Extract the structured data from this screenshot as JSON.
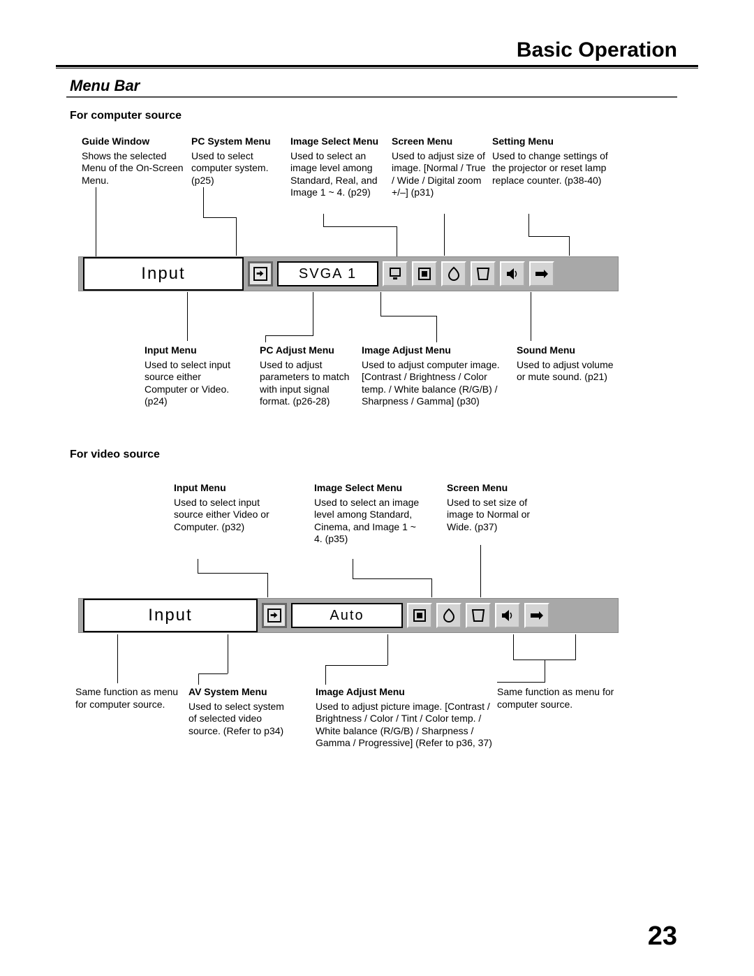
{
  "pageHeader": "Basic Operation",
  "pageNumber": "23",
  "sectionTitle": "Menu Bar",
  "computer": {
    "heading": "For computer source",
    "menubar": {
      "guide": "Input",
      "sys": "SVGA 1"
    },
    "top": {
      "guide": {
        "h": "Guide Window",
        "b": "Shows the selected Menu of the On-Screen Menu."
      },
      "pcsys": {
        "h": "PC System Menu",
        "b": "Used to select computer system. (p25)"
      },
      "imgsel": {
        "h": "Image Select Menu",
        "b": "Used to select  an image level among Standard, Real, and Image 1 ~ 4. (p29)"
      },
      "screen": {
        "h": "Screen Menu",
        "b": "Used to adjust size of image.  [Normal / True / Wide / Digital zoom +/–] (p31)"
      },
      "setting": {
        "h": "Setting Menu",
        "b": "Used to change settings of the projector or reset  lamp replace counter.   (p38-40)"
      }
    },
    "bottom": {
      "input": {
        "h": "Input Menu",
        "b": "Used to select input source either Computer or Video.  (p24)"
      },
      "pcadj": {
        "h": "PC Adjust Menu",
        "b": "Used to adjust parameters to match with input signal format. (p26-28)"
      },
      "imgadj": {
        "h": "Image Adjust Menu",
        "b": "Used to adjust computer image. [Contrast / Brightness / Color temp. /  White balance (R/G/B) / Sharpness /  Gamma]   (p30)"
      },
      "sound": {
        "h": "Sound Menu",
        "b": "Used to adjust volume or mute sound.  (p21)"
      }
    }
  },
  "video": {
    "heading": "For video source",
    "menubar": {
      "guide": "Input",
      "sys": "Auto"
    },
    "top": {
      "input": {
        "h": "Input Menu",
        "b": "Used to select input source either Video or Computer. (p32)"
      },
      "imgsel": {
        "h": "Image Select Menu",
        "b": "Used to select an image level among Standard, Cinema, and Image 1 ~ 4. (p35)"
      },
      "screen": {
        "h": "Screen Menu",
        "b": "Used to set size of image to  Normal or Wide.  (p37)"
      }
    },
    "bottom": {
      "same1": {
        "b": "Same function as menu for computer source."
      },
      "avsys": {
        "h": "AV System Menu",
        "b": "Used to select system of selected video source. (Refer to p34)"
      },
      "imgadj": {
        "h": "Image Adjust Menu",
        "b": " Used to adjust picture image. [Contrast / Brightness / Color / Tint / Color temp. / White balance (R/G/B) / Sharpness /  Gamma / Progressive] (Refer to p36, 37)"
      },
      "same2": {
        "b": "Same function as menu for computer source."
      }
    }
  }
}
